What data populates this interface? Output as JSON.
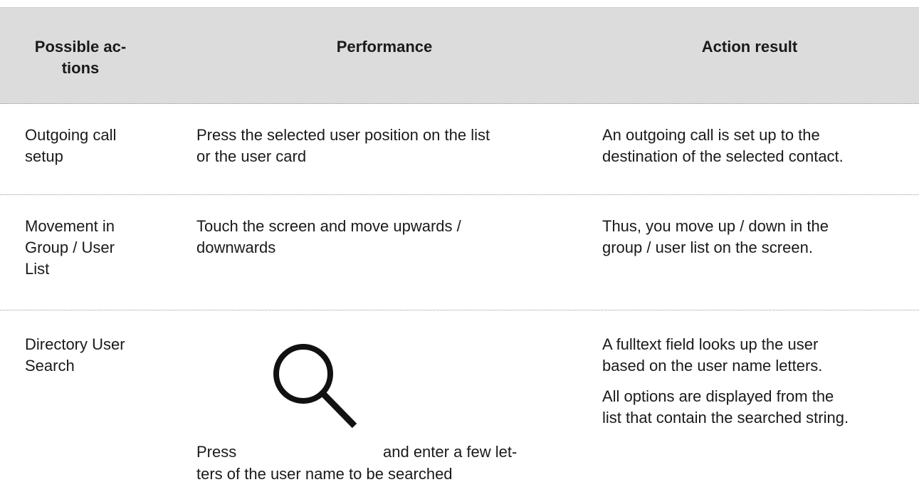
{
  "table": {
    "headers": [
      "Possible ac-\ntions",
      "Performance",
      "Action result"
    ],
    "rows": [
      {
        "action": "Outgoing call\nsetup",
        "performance": "Press the selected user position on the list\nor the user card",
        "result": "An outgoing call is set up to the\ndestination of the selected contact."
      },
      {
        "action": "Movement in\nGroup / User\nList",
        "performance": "Touch the screen and move upwards /\ndownwards",
        "result": "Thus, you move up / down in the\ngroup / user list on the screen."
      },
      {
        "action": "Directory User\nSearch",
        "performance_press": "Press",
        "performance_rest": "and enter a few let-",
        "performance_line2": "ters of the user name to be searched",
        "performance_icon": "search-icon",
        "result_p1": "A fulltext field looks up the user\nbased on the user name letters.",
        "result_p2": "All options are displayed from the\nlist that contain the searched string."
      }
    ]
  }
}
